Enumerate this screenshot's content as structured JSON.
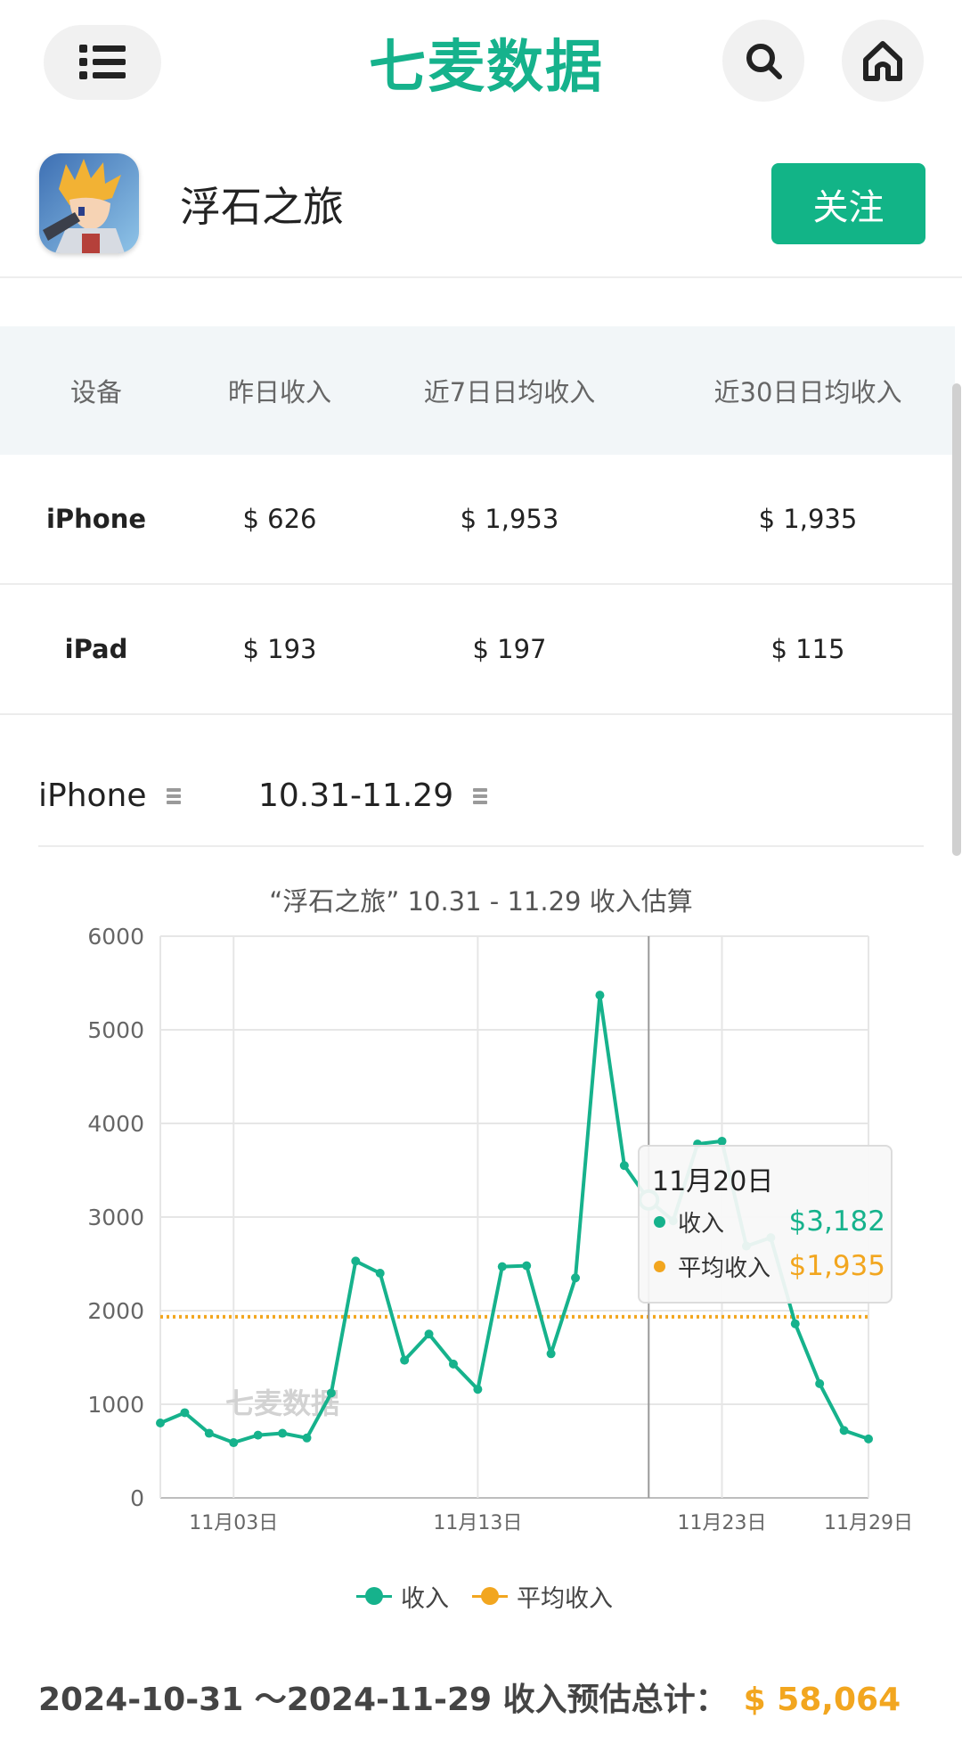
{
  "header": {
    "logo_text": "七麦数据",
    "menu_icon": "list-menu-icon",
    "search_icon": "search-icon",
    "home_icon": "home-icon",
    "brand_color": "#16b28c"
  },
  "app": {
    "name": "浮石之旅",
    "follow_label": "关注"
  },
  "table": {
    "headers": [
      "设备",
      "昨日收入",
      "近7日日均收入",
      "近30日日均收入"
    ],
    "rows": [
      {
        "device": "iPhone",
        "yesterday": "$ 626",
        "avg7": "$ 1,953",
        "avg30": "$ 1,935"
      },
      {
        "device": "iPad",
        "yesterday": "$ 193",
        "avg7": "$ 197",
        "avg30": "$ 115"
      }
    ]
  },
  "selectors": {
    "device": "iPhone",
    "date_range": "10.31-11.29"
  },
  "chart_data": {
    "type": "line",
    "title": "“浮石之旅”  10.31 - 11.29 收入估算",
    "x": [
      "10-31",
      "11-01",
      "11-02",
      "11-03",
      "11-04",
      "11-05",
      "11-06",
      "11-07",
      "11-08",
      "11-09",
      "11-10",
      "11-11",
      "11-12",
      "11-13",
      "11-14",
      "11-15",
      "11-16",
      "11-17",
      "11-18",
      "11-19",
      "11-20",
      "11-21",
      "11-22",
      "11-23",
      "11-24",
      "11-25",
      "11-26",
      "11-27",
      "11-28",
      "11-29"
    ],
    "x_tick_labels": [
      "11月03日",
      "11月13日",
      "11月23日",
      "11月29日"
    ],
    "x_tick_dates": [
      "11-03",
      "11-13",
      "11-23",
      "11-29"
    ],
    "ylim": [
      0,
      6000
    ],
    "y_ticks": [
      0,
      1000,
      2000,
      3000,
      4000,
      5000,
      6000
    ],
    "series": [
      {
        "name": "收入",
        "color": "#16b28c",
        "values": [
          800,
          910,
          690,
          590,
          670,
          690,
          640,
          1120,
          2530,
          2400,
          1470,
          1750,
          1430,
          1160,
          2470,
          2480,
          1540,
          2350,
          5370,
          3550,
          3182,
          2960,
          3780,
          3810,
          2690,
          2780,
          1860,
          1220,
          720,
          630
        ]
      },
      {
        "name": "平均收入",
        "color": "#f2a61f",
        "values": [
          1935,
          1935,
          1935,
          1935,
          1935,
          1935,
          1935,
          1935,
          1935,
          1935,
          1935,
          1935,
          1935,
          1935,
          1935,
          1935,
          1935,
          1935,
          1935,
          1935,
          1935,
          1935,
          1935,
          1935,
          1935,
          1935,
          1935,
          1935,
          1935,
          1935
        ]
      }
    ],
    "watermark": "七麦数据",
    "grid": true,
    "legend_position": "bottom-center",
    "tooltip": {
      "date": "11月20日",
      "index": 20,
      "items": [
        {
          "label": "收入",
          "value": "$3,182"
        },
        {
          "label": "平均收入",
          "value": "$1,935"
        }
      ]
    }
  },
  "summary": {
    "label": "2024-10-31 ～2024-11-29 收入预估总计：",
    "value": "$ 58,064"
  }
}
